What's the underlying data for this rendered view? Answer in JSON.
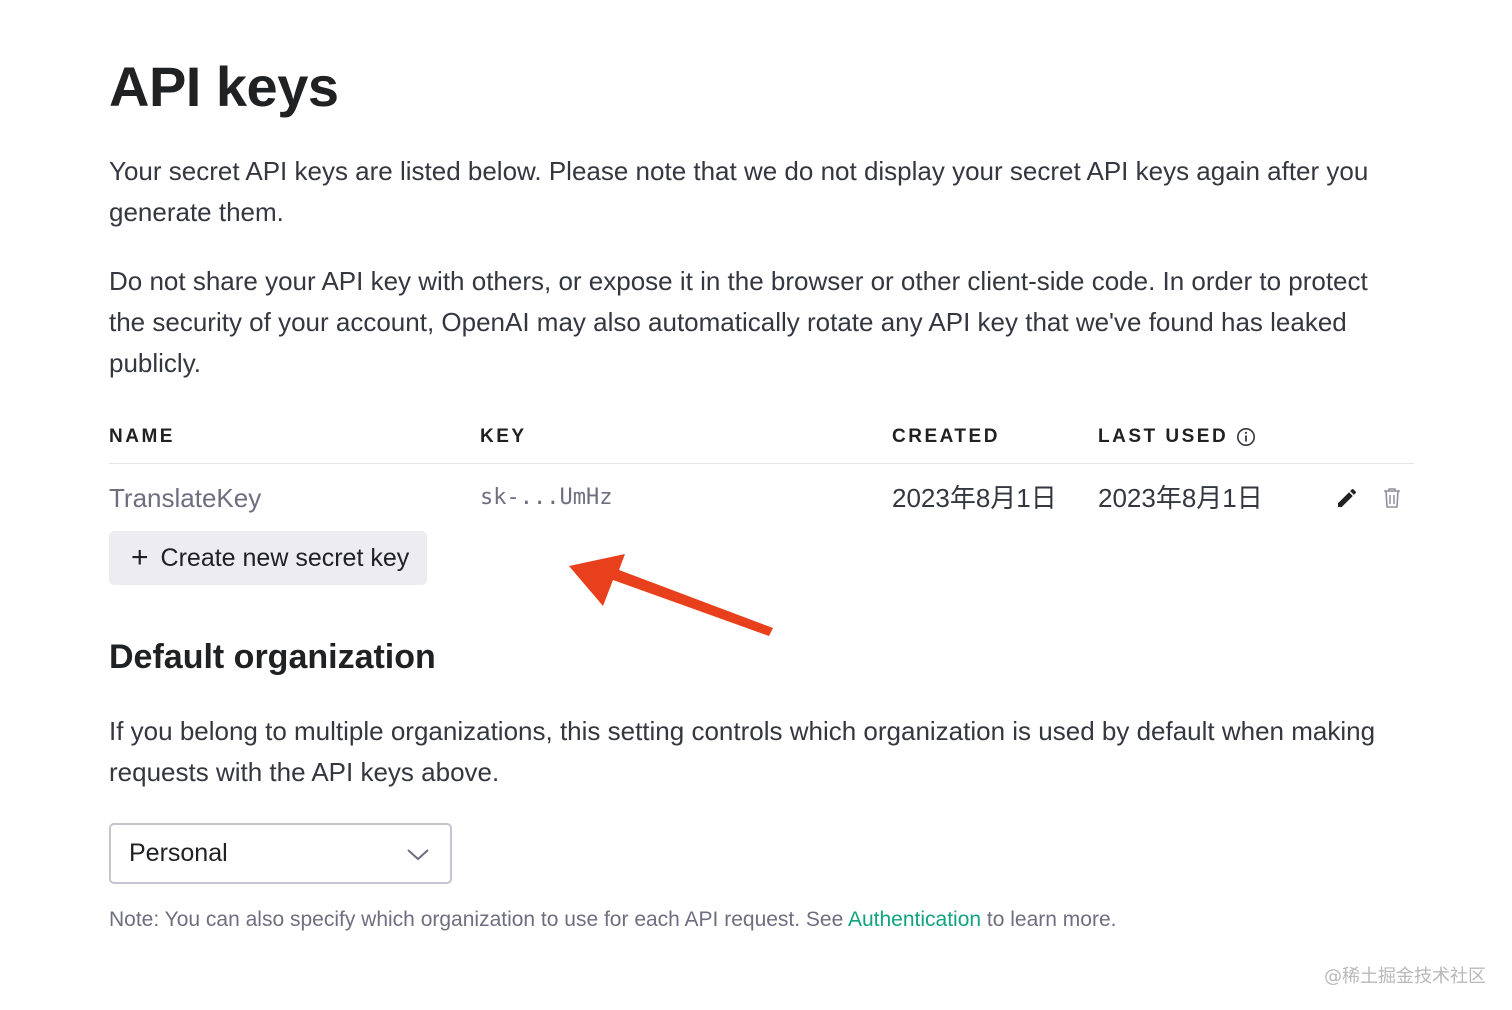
{
  "page": {
    "title": "API keys",
    "intro": "Your secret API keys are listed below. Please note that we do not display your secret API keys again after you generate them.",
    "warning": "Do not share your API key with others, or expose it in the browser or other client-side code. In order to protect the security of your account, OpenAI may also automatically rotate any API key that we've found has leaked publicly."
  },
  "table": {
    "headers": {
      "name": "NAME",
      "key": "KEY",
      "created": "CREATED",
      "last_used": "LAST USED"
    },
    "rows": [
      {
        "name": "TranslateKey",
        "key": "sk-...UmHz",
        "created": "2023年8月1日",
        "last_used": "2023年8月1日"
      }
    ],
    "row_icons": [
      "pencil-icon",
      "trash-icon"
    ]
  },
  "create_button": {
    "icon": "plus-icon",
    "plus_glyph": "+",
    "label": "Create new secret key"
  },
  "default_org": {
    "title": "Default organization",
    "description": "If you belong to multiple organizations, this setting controls which organization is used by default when making requests with the API keys above.",
    "selected": "Personal",
    "note_before": "Note: You can also specify which organization to use for each API request. See ",
    "note_link": "Authentication",
    "note_after": " to learn more."
  },
  "watermark": "@稀土掘金技术社区",
  "colors": {
    "accent_link": "#10a37f",
    "annotation_arrow": "#e8401c",
    "button_bg": "#ececf1"
  }
}
